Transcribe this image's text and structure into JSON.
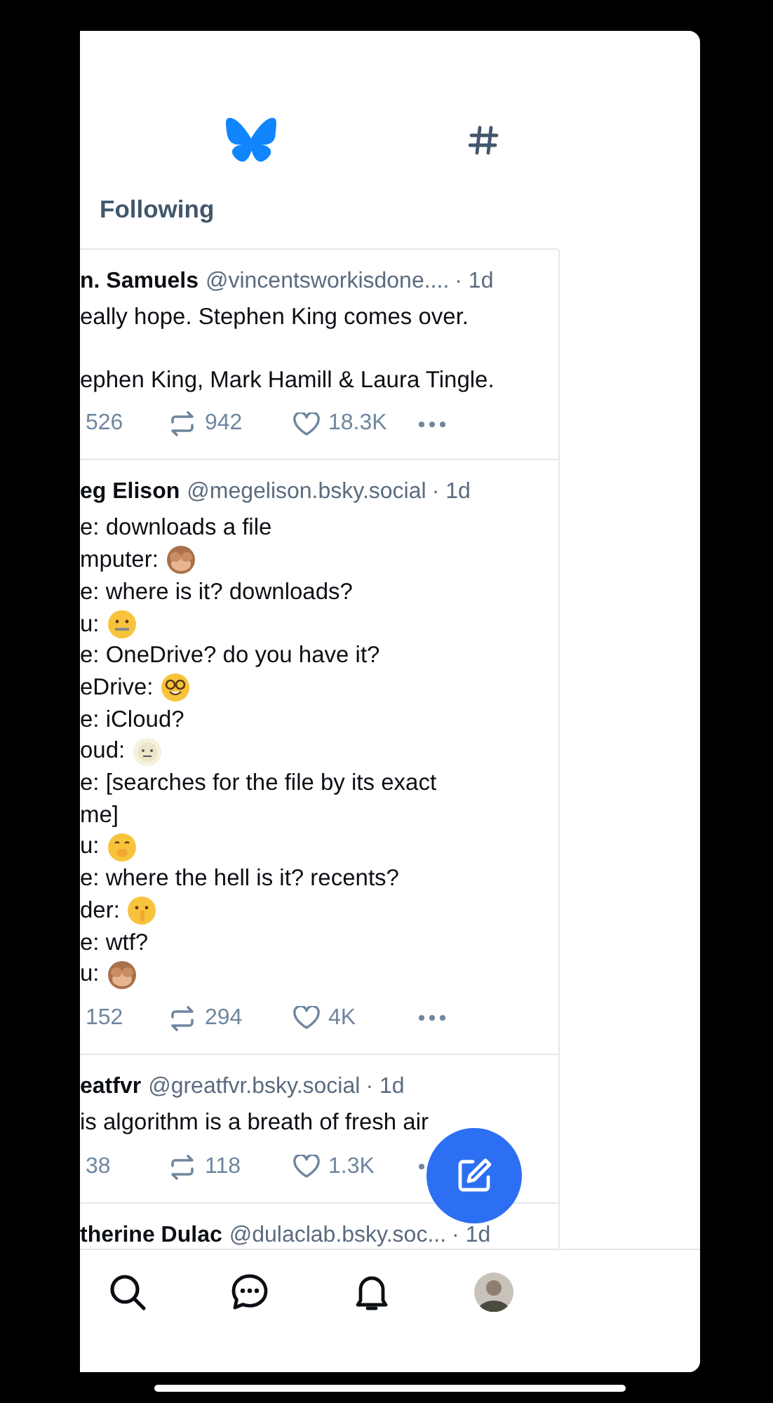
{
  "tabs": [
    {
      "label": "Following",
      "selected": false
    }
  ],
  "posts": [
    {
      "author": "n. Samuels",
      "handle": "@vincentsworkisdone....",
      "time": "· 1d",
      "paragraphs": [
        [
          {
            "text": "eally hope. Stephen King comes over."
          }
        ],
        [
          {
            "text": "ephen King, Mark Hamill & Laura Tingle."
          }
        ]
      ],
      "replies": "526",
      "reposts": "942",
      "likes": "18.3K"
    },
    {
      "author": "eg Elison",
      "handle": "@megelison.bsky.social",
      "time": "· 1d",
      "paragraphs": [
        [
          {
            "text": "e: downloads a file"
          },
          {
            "text": "mputer:",
            "kind": "monkey"
          },
          {
            "text": "e: where is it? downloads?"
          },
          {
            "text": "u:",
            "kind": "zipper"
          },
          {
            "text": "e: OneDrive? do you have it?"
          },
          {
            "text": "eDrive:",
            "kind": "nerd"
          },
          {
            "text": "e: iCloud?"
          },
          {
            "text": "oud:",
            "kind": "cloud"
          },
          {
            "text": "e: [searches for the file by its exact"
          },
          {
            "text": "me]"
          },
          {
            "text": "u:",
            "kind": "giggle"
          },
          {
            "text": "e: where the hell is it? recents?"
          },
          {
            "text": "der:",
            "kind": "shush"
          },
          {
            "text": "e: wtf?"
          },
          {
            "text": "u:",
            "kind": "monkey"
          }
        ]
      ],
      "replies": "152",
      "reposts": "294",
      "likes": "4K"
    },
    {
      "author": "eatfvr",
      "handle": "@greatfvr.bsky.social",
      "time": "· 1d",
      "paragraphs": [
        [
          {
            "text": "is algorithm is a breath of fresh air"
          }
        ]
      ],
      "replies": "38",
      "reposts": "118",
      "likes": "1.3K"
    },
    {
      "author": "therine Dulac",
      "handle": "@dulaclab.bsky.soc...",
      "time": "· 1d"
    }
  ]
}
